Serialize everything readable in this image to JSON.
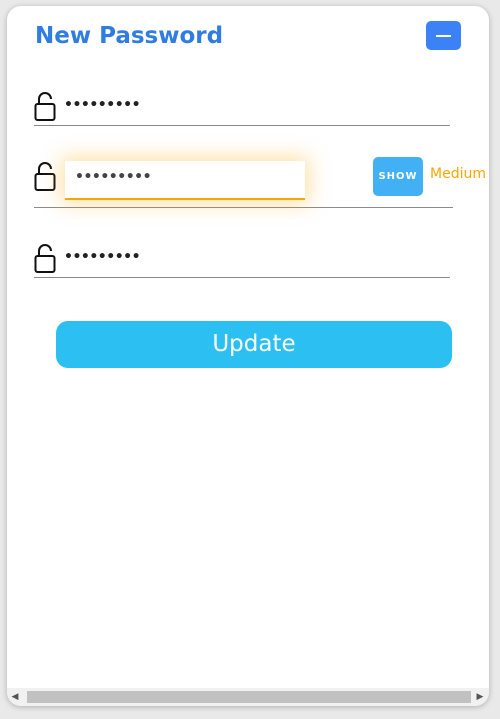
{
  "dialog": {
    "title": "New Password",
    "minimize_icon": "minus-icon"
  },
  "fields": [
    {
      "icon": "unlock-icon",
      "value": "•••••••••"
    },
    {
      "icon": "unlock-icon",
      "value": "•••••••••"
    },
    {
      "icon": "unlock-icon",
      "value": "•••••••••"
    }
  ],
  "show_button": {
    "label": "SHOW"
  },
  "strength": {
    "label": "Medium",
    "color": "#ffa500"
  },
  "update_button": {
    "label": "Update"
  },
  "colors": {
    "title": "#2f7de1",
    "update_button": "#2bbff2",
    "show_button": "#42b0f5"
  }
}
